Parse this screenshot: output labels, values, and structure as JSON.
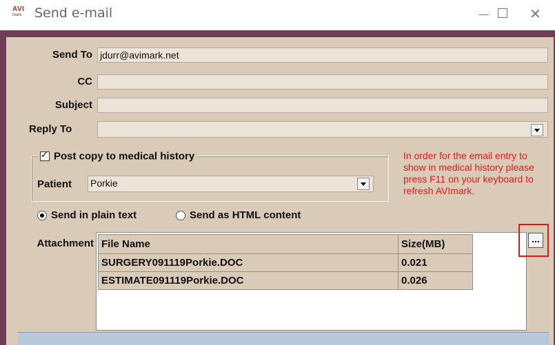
{
  "window": {
    "title": "Send e-mail",
    "logo_top": "AVI",
    "logo_bottom": "mark",
    "frame_color": "#6e3e57",
    "client_color": "#dacbb8"
  },
  "form": {
    "send_to": {
      "label": "Send To",
      "value": "jdurr@avimark.net"
    },
    "cc": {
      "label": "CC",
      "value": ""
    },
    "subject": {
      "label": "Subject",
      "value": ""
    },
    "reply_to": {
      "label": "Reply To",
      "value": ""
    }
  },
  "medical_history": {
    "checkbox_label": "Post copy to medical history",
    "checked": true,
    "patient_label": "Patient",
    "patient_value": "Porkie"
  },
  "note": {
    "text": "In order for the email entry to show in medical history please press F11 on your keyboard to refresh AVImark.",
    "color": "#e01818"
  },
  "format": {
    "plain_label": "Send in plain text",
    "html_label": "Send as HTML content",
    "selected": "plain"
  },
  "attachment": {
    "label": "Attachment",
    "columns": [
      "File Name",
      "Size(MB)"
    ],
    "rows": [
      {
        "name": "SURGERY091119Porkie.DOC",
        "size": "0.021"
      },
      {
        "name": "ESTIMATE091119Porkie.DOC",
        "size": "0.026"
      }
    ],
    "browse_label": "..."
  }
}
